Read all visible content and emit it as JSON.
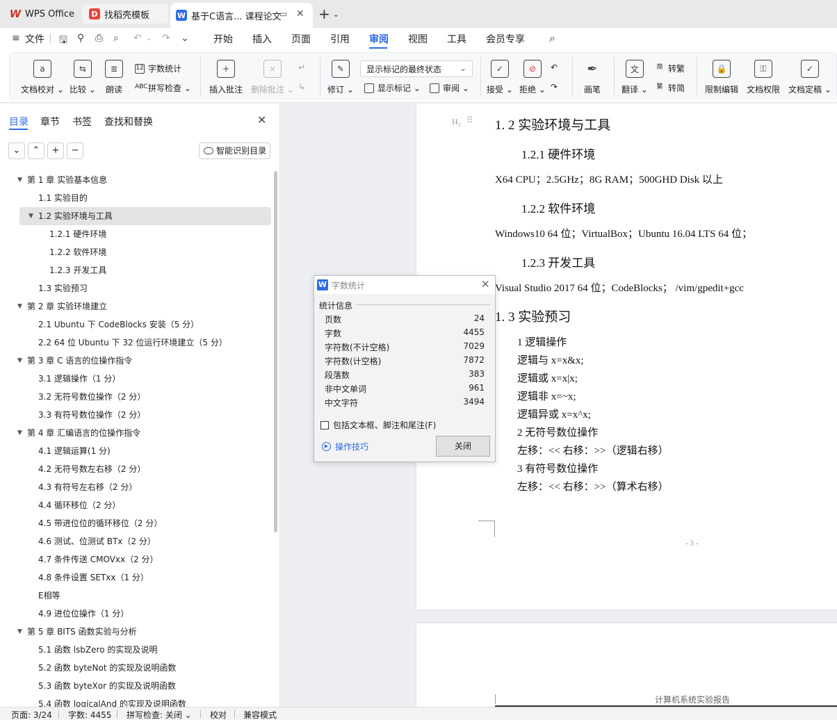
{
  "tabs": {
    "wps": "WPS Office",
    "template": "找稻壳模板",
    "document": "基于C语言... 课程论文"
  },
  "menu": {
    "file": "文件",
    "items": [
      "开始",
      "插入",
      "页面",
      "引用",
      "审阅",
      "视图",
      "工具",
      "会员专享"
    ],
    "active": "审阅"
  },
  "ribbon": {
    "doc_proofread": "文档校对",
    "compare": "比较",
    "read_aloud": "朗读",
    "word_count": "字数统计",
    "spell_check": "拼写检查",
    "insert_comment": "插入批注",
    "delete_comment": "删除批注",
    "track_changes": "修订",
    "markup_state": "显示标记的最终状态",
    "show_markup": "显示标记",
    "review_pane": "审阅",
    "accept": "接受",
    "reject": "拒绝",
    "pen": "画笔",
    "translate": "翻译",
    "to_traditional": "转繁",
    "to_simplified": "转简",
    "restrict_edit": "限制编辑",
    "doc_permission": "文档权限",
    "doc_finalize": "文档定稿"
  },
  "nav": {
    "tabs": [
      "目录",
      "章节",
      "书签",
      "查找和替换"
    ],
    "smart_toc": "智能识别目录",
    "toc": [
      {
        "level": 1,
        "arrow": "▼",
        "text": "第 1 章  实验基本信息"
      },
      {
        "level": 2,
        "arrow": "",
        "text": "1.1  实验目的"
      },
      {
        "level": 2,
        "arrow": "▼",
        "text": "1.2  实验环境与工具",
        "selected": true
      },
      {
        "level": 3,
        "arrow": "",
        "text": "1.2.1  硬件环境"
      },
      {
        "level": 3,
        "arrow": "",
        "text": "1.2.2  软件环境"
      },
      {
        "level": 3,
        "arrow": "",
        "text": "1.2.3  开发工具"
      },
      {
        "level": 2,
        "arrow": "",
        "text": "1.3  实验预习"
      },
      {
        "level": 1,
        "arrow": "▼",
        "text": "第 2 章  实验环境建立"
      },
      {
        "level": 2,
        "arrow": "",
        "text": "2.1 Ubuntu 下 CodeBlocks 安装（5 分）"
      },
      {
        "level": 2,
        "arrow": "",
        "text": "2.2 64 位 Ubuntu 下 32 位运行环境建立（5 分）"
      },
      {
        "level": 1,
        "arrow": "▼",
        "text": "第 3 章  C 语言的位操作指令"
      },
      {
        "level": 2,
        "arrow": "",
        "text": "3.1  逻辑操作（1 分）"
      },
      {
        "level": 2,
        "arrow": "",
        "text": "3.2  无符号数位操作（2 分）"
      },
      {
        "level": 2,
        "arrow": "",
        "text": "3.3  有符号数位操作（2 分）"
      },
      {
        "level": 1,
        "arrow": "▼",
        "text": "第 4 章  汇编语言的位操作指令"
      },
      {
        "level": 2,
        "arrow": "",
        "text": "4.1  逻辑运算(1 分)"
      },
      {
        "level": 2,
        "arrow": "",
        "text": "4.2 无符号数左右移（2 分）"
      },
      {
        "level": 2,
        "arrow": "",
        "text": "4.3 有符号左右移（2 分）"
      },
      {
        "level": 2,
        "arrow": "",
        "text": "4.4 循环移位（2 分）"
      },
      {
        "level": 2,
        "arrow": "",
        "text": "4.5 带进位位的循环移位（2 分）"
      },
      {
        "level": 2,
        "arrow": "",
        "text": "4.6 测试、位测试 BTx（2 分）"
      },
      {
        "level": 2,
        "arrow": "",
        "text": "4.7 条件传送 CMOVxx（2 分）"
      },
      {
        "level": 2,
        "arrow": "",
        "text": "4.8 条件设置 SETxx（1 分）"
      },
      {
        "level": 2,
        "arrow": "",
        "text": "E相等"
      },
      {
        "level": 2,
        "arrow": "",
        "text": "4.9 进位位操作（1 分）"
      },
      {
        "level": 1,
        "arrow": "▼",
        "text": "第 5 章  BITS 函数实验与分析"
      },
      {
        "level": 2,
        "arrow": "",
        "text": "5.1  函数 lsbZero 的实现及说明"
      },
      {
        "level": 2,
        "arrow": "",
        "text": "5.2  函数 byteNot 的实现及说明函数"
      },
      {
        "level": 2,
        "arrow": "",
        "text": "5.3  函数 byteXor 的实现及说明函数"
      },
      {
        "level": 2,
        "arrow": "",
        "text": "5.4  函数 logicalAnd 的实现及说明函数"
      }
    ]
  },
  "document": {
    "h2_marker": "H₂",
    "h2_1": "1. 2  实验环境与工具",
    "h3_1": "1.2.1  硬件环境",
    "hw": "X64 CPU；2.5GHz；8G RAM；500GHD Disk  以上",
    "h3_2": "1.2.2  软件环境",
    "sw": "Windows10 64 位；VirtualBox；Ubuntu 16.04 LTS 64 位；",
    "h3_3": "1.2.3  开发工具",
    "tools": "Visual Studio 2017 64 位；CodeBlocks；  /vim/gpedit+gcc",
    "h2_2": "1. 3  实验预习",
    "lines": [
      "1  逻辑操作",
      "逻辑与 x=x&x;",
      "逻辑或 x=x|x;",
      "逻辑非 x=~x;",
      "逻辑异或 x=x^x;",
      "2  无符号数位操作",
      "左移：<<  右移：>>（逻辑右移）",
      "3  有符号数位操作",
      "左移：<<   右移：>>（算术右移）"
    ],
    "page_number": "- 3 -",
    "footer": "计算机系统实验报告"
  },
  "dialog": {
    "title": "字数统计",
    "group": "统计信息",
    "stats": [
      {
        "label": "页数",
        "value": "24"
      },
      {
        "label": "字数",
        "value": "4455"
      },
      {
        "label": "字符数(不计空格)",
        "value": "7029"
      },
      {
        "label": "字符数(计空格)",
        "value": "7872"
      },
      {
        "label": "段落数",
        "value": "383"
      },
      {
        "label": "非中文单词",
        "value": "961"
      },
      {
        "label": "中文字符",
        "value": "3494"
      }
    ],
    "include_label": "包括文本框、脚注和尾注(F)",
    "tips": "操作技巧",
    "close": "关闭"
  },
  "status": {
    "page": "页面: 3/24",
    "words": "字数: 4455",
    "spell": "拼写检查: 关闭",
    "proof": "校对",
    "compat": "兼容模式"
  }
}
